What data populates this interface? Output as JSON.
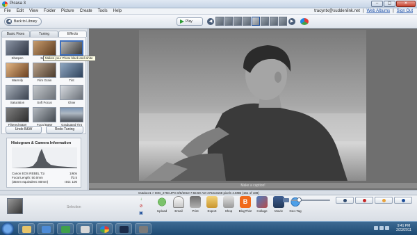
{
  "window": {
    "title": "Picasa 3",
    "controls": [
      "–",
      "▢",
      "✕"
    ]
  },
  "menu": [
    "File",
    "Edit",
    "View",
    "Folder",
    "Picture",
    "Create",
    "Tools",
    "Help"
  ],
  "account": {
    "email": "tracyntx@suddenlink.net",
    "sep1": "|",
    "web_albums": "Web Albums",
    "sep2": "|",
    "sign_out": "Sign Out"
  },
  "toolbar": {
    "back_label": "Back to Library",
    "play_label": "Play",
    "prev_icon": "◀",
    "next_icon": "▶",
    "back_icon": "◀"
  },
  "tabs": [
    "Basic Fixes",
    "Tuning",
    "Effects"
  ],
  "effects": {
    "items": [
      "Sharpen",
      "Sepia",
      "B&W",
      "Warmify",
      "Film Grain",
      "Tint",
      "Saturation",
      "Soft Focus",
      "Glow",
      "Filtered B&W",
      "Focal B&W",
      "Graduated Tint"
    ],
    "tooltip": "Makes your Photo black and white",
    "undo_label": "Undo B&W",
    "redo_label": "Redo Tuning"
  },
  "histogram": {
    "title": "Histogram & Camera Information",
    "rows": [
      {
        "label": "Canon EOS REBEL T1i",
        "value": "1/60s"
      },
      {
        "label": "Focal Length: 50.0mm",
        "value": "f/3.5"
      },
      {
        "label": "(35mm equivalent: 80mm)",
        "value": "ISO: 100"
      }
    ]
  },
  "caption_placeholder": "Make a caption!",
  "status": "Outdoor1 > IMG_2750.JPG   8/5/2010 7:55:59 AM   4752x3168 pixels   4.6MB   (151 of 188)",
  "tray": {
    "selection_label": "Selection",
    "side_icons": [
      "↓",
      "⊘",
      "▣"
    ],
    "actions": [
      "Upload",
      "Email",
      "Print",
      "Export",
      "Shop",
      "BlogThis!",
      "Collage",
      "Movie",
      "Geo-Tag"
    ],
    "blog_glyph": "B"
  },
  "taskbar": {
    "time": "9:41 PM",
    "date": "2/23/2011"
  },
  "colors": {
    "accent": "#1a4ea8",
    "blogger": "#f06a1c",
    "upload": "#3b8a31"
  }
}
